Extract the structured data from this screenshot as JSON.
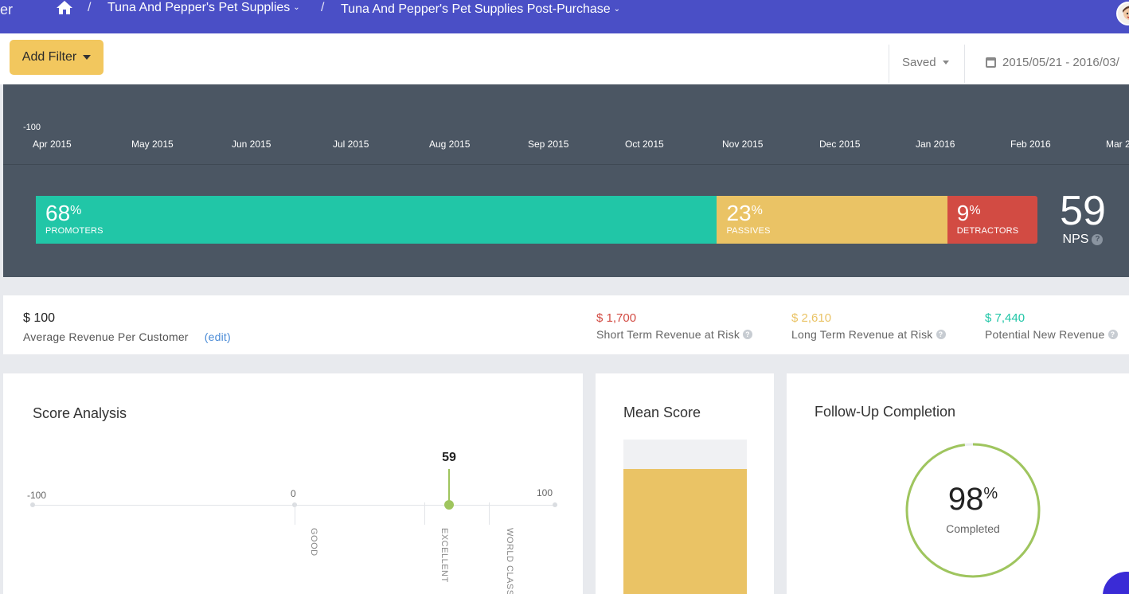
{
  "nav": {
    "brand_fragment": "er",
    "breadcrumbs": [
      {
        "label": "Tuna And Pepper's Pet Supplies"
      },
      {
        "label": "Tuna And Pepper's Pet Supplies Post-Purchase"
      }
    ],
    "separator": "/"
  },
  "filterbar": {
    "add_filter": "Add Filter",
    "saved": "Saved",
    "date_range": "2015/05/21 - 2016/03/"
  },
  "trend": {
    "y_tick": "-100",
    "months": [
      "Apr 2015",
      "May 2015",
      "Jun 2015",
      "Jul 2015",
      "Aug 2015",
      "Sep 2015",
      "Oct 2015",
      "Nov 2015",
      "Dec 2015",
      "Jan 2016",
      "Feb 2016",
      "Mar 2"
    ]
  },
  "nps": {
    "promoters": {
      "pct": "68",
      "label": "PROMOTERS",
      "value": 68,
      "color": "#21c6a7"
    },
    "passives": {
      "pct": "23",
      "label": "PASSIVES",
      "value": 23,
      "color": "#eac365"
    },
    "detractors": {
      "pct": "9",
      "label": "DETRACTORS",
      "value": 9,
      "color": "#d24b43"
    },
    "percent_sign": "%",
    "score": "59",
    "score_label": "NPS",
    "help": "?"
  },
  "revenue": {
    "avg_value": "$ 100",
    "avg_label": "Average Revenue Per Customer",
    "edit": "(edit)",
    "short_value": "$ 1,700",
    "short_label": "Short Term Revenue at Risk",
    "long_value": "$ 2,610",
    "long_label": "Long Term Revenue at Risk",
    "potential_value": "$ 7,440",
    "potential_label": "Potential New Revenue",
    "colors": {
      "short": "#d24b43",
      "long": "#eac365",
      "potential": "#21c6a7"
    }
  },
  "score_analysis": {
    "title": "Score Analysis",
    "min": "-100",
    "zero": "0",
    "max": "100",
    "score": "59",
    "score_value": 59,
    "zones": [
      "GOOD",
      "EXCELLENT",
      "WORLD CLASS"
    ]
  },
  "mean_score": {
    "title": "Mean Score"
  },
  "follow_up": {
    "title": "Follow-Up Completion",
    "pct": "98",
    "value": 98,
    "label": "Completed",
    "color": "#9fc55e"
  }
}
